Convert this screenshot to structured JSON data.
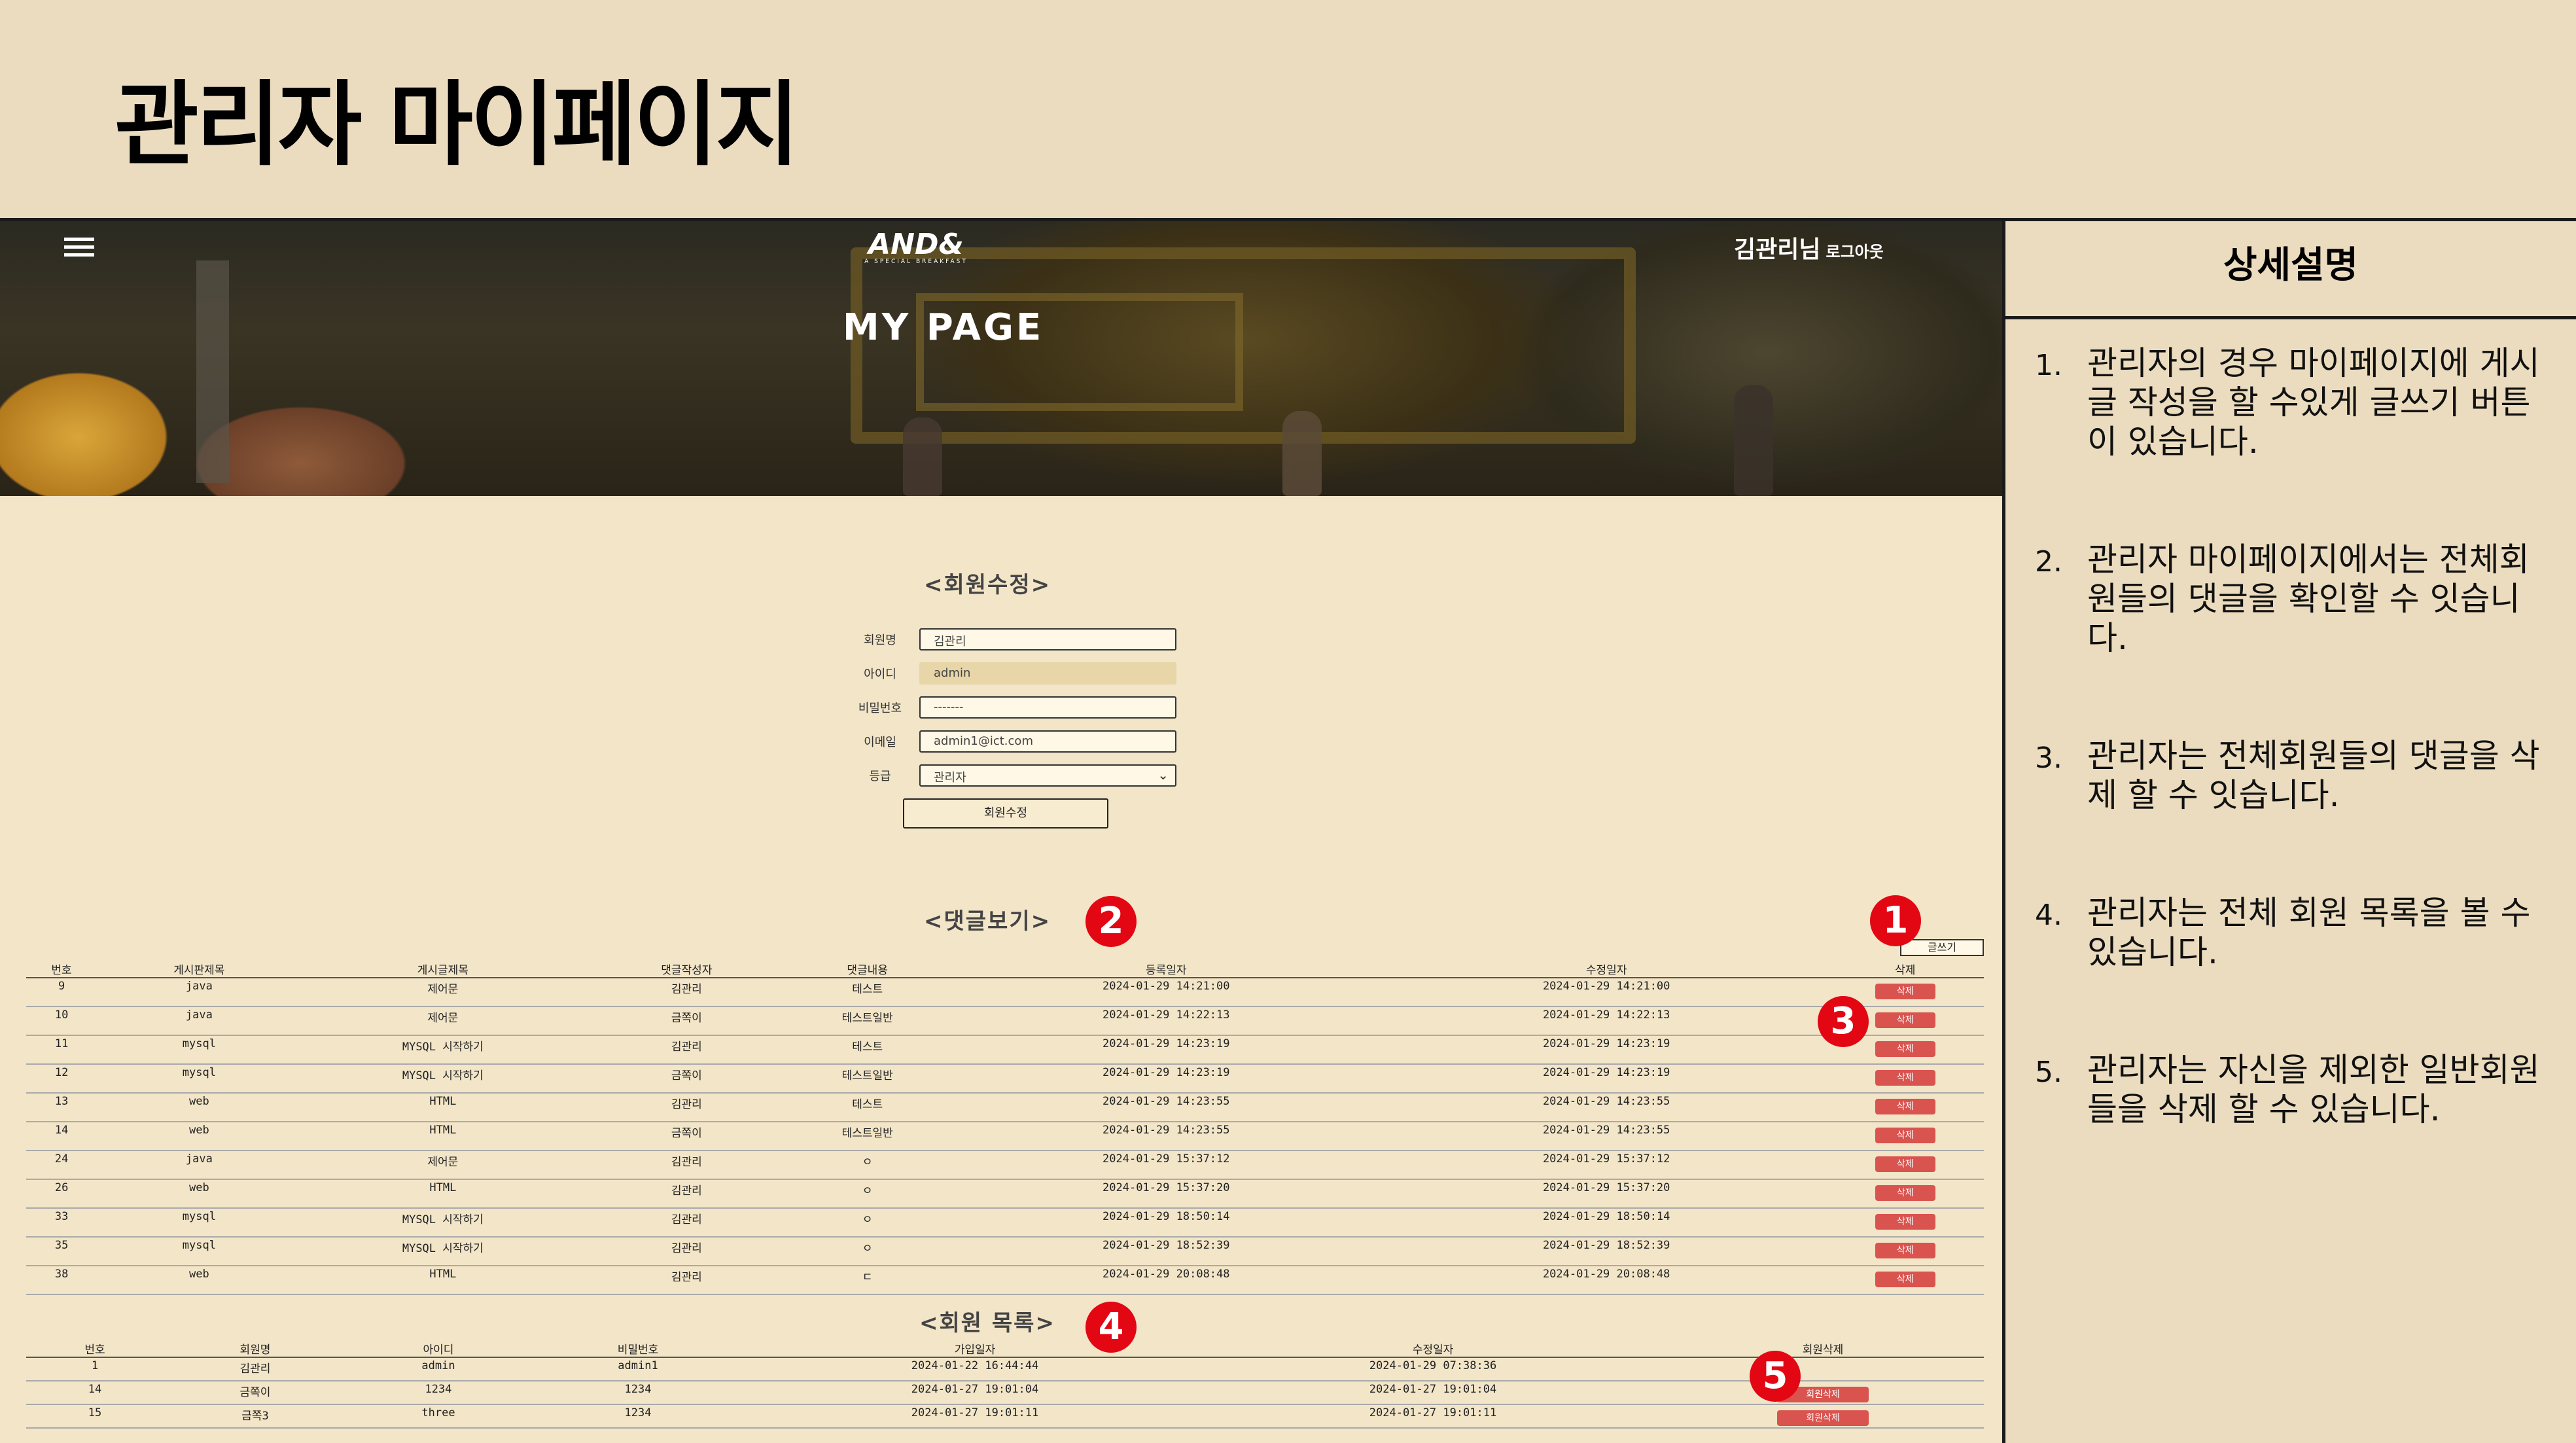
{
  "slide": {
    "title": "관리자 마이페이지"
  },
  "hero": {
    "logo": "AND&",
    "logo_sub": "A SPECIAL BREAKFAST",
    "user": "김관리님",
    "logout": "로그아웃",
    "title": "MY PAGE"
  },
  "member_edit": {
    "title": "<회원수정>",
    "name_label": "회원명",
    "name_value": "김관리",
    "id_label": "아이디",
    "id_value": "admin",
    "pw_label": "비밀번호",
    "pw_value": "-------",
    "email_label": "이메일",
    "email_value": "admin1@ict.com",
    "grade_label": "등급",
    "grade_value": "관리자",
    "submit": "회원수정"
  },
  "comments": {
    "title": "<댓글보기>",
    "write_button": "글쓰기",
    "headers": [
      "번호",
      "게시판제목",
      "게시글제목",
      "댓글작성자",
      "댓글내용",
      "등록일자",
      "수정일자",
      "삭제"
    ],
    "delete_label": "삭제",
    "rows": [
      [
        "9",
        "java",
        "제어문",
        "김관리",
        "테스트",
        "2024-01-29 14:21:00",
        "2024-01-29 14:21:00"
      ],
      [
        "10",
        "java",
        "제어문",
        "금쪽이",
        "테스트일반",
        "2024-01-29 14:22:13",
        "2024-01-29 14:22:13"
      ],
      [
        "11",
        "mysql",
        "MYSQL 시작하기",
        "김관리",
        "테스트",
        "2024-01-29 14:23:19",
        "2024-01-29 14:23:19"
      ],
      [
        "12",
        "mysql",
        "MYSQL 시작하기",
        "금쪽이",
        "테스트일반",
        "2024-01-29 14:23:19",
        "2024-01-29 14:23:19"
      ],
      [
        "13",
        "web",
        "HTML",
        "김관리",
        "테스트",
        "2024-01-29 14:23:55",
        "2024-01-29 14:23:55"
      ],
      [
        "14",
        "web",
        "HTML",
        "금쪽이",
        "테스트일반",
        "2024-01-29 14:23:55",
        "2024-01-29 14:23:55"
      ],
      [
        "24",
        "java",
        "제어문",
        "김관리",
        "ㅇ",
        "2024-01-29 15:37:12",
        "2024-01-29 15:37:12"
      ],
      [
        "26",
        "web",
        "HTML",
        "김관리",
        "ㅇ",
        "2024-01-29 15:37:20",
        "2024-01-29 15:37:20"
      ],
      [
        "33",
        "mysql",
        "MYSQL 시작하기",
        "김관리",
        "ㅇ",
        "2024-01-29 18:50:14",
        "2024-01-29 18:50:14"
      ],
      [
        "35",
        "mysql",
        "MYSQL 시작하기",
        "김관리",
        "ㅇ",
        "2024-01-29 18:52:39",
        "2024-01-29 18:52:39"
      ],
      [
        "38",
        "web",
        "HTML",
        "김관리",
        "ㄷ",
        "2024-01-29 20:08:48",
        "2024-01-29 20:08:48"
      ]
    ]
  },
  "members": {
    "title": "<회원 목록>",
    "headers": [
      "번호",
      "회원명",
      "아이디",
      "비밀번호",
      "가입일자",
      "수정일자",
      "회원삭제"
    ],
    "delete_label": "회원삭제",
    "rows": [
      [
        "1",
        "김관리",
        "admin",
        "admin1",
        "2024-01-22 16:44:44",
        "2024-01-29 07:38:36",
        false
      ],
      [
        "14",
        "금쪽이",
        "1234",
        "1234",
        "2024-01-27 19:01:04",
        "2024-01-27 19:01:04",
        true
      ],
      [
        "15",
        "금쪽3",
        "three",
        "1234",
        "2024-01-27 19:01:11",
        "2024-01-27 19:01:11",
        true
      ]
    ]
  },
  "badges": [
    "1",
    "2",
    "3",
    "4",
    "5"
  ],
  "panel": {
    "title": "상세설명",
    "notes": [
      {
        "num": "1.",
        "text": "관리자의 경우  마이페이지에 게시글 작성을 할 수있게 글쓰기 버튼이 있습니다."
      },
      {
        "num": "2.",
        "text": "관리자 마이페이지에서는 전체회원들의 댓글을 확인할 수 잇습니다."
      },
      {
        "num": "3.",
        "text": "관리자는 전체회원들의 댓글을 삭제 할 수 잇습니다."
      },
      {
        "num": "4.",
        "text": "관리자는 전체 회원 목록을 볼 수 있습니다."
      },
      {
        "num": "5.",
        "text": "관리자는 자신을 제외한 일반회원들을 삭제 할 수 있습니다."
      }
    ]
  },
  "colors": {
    "background": "#ebdcbf",
    "page": "#f2e5c8",
    "delete": "#d9534f",
    "badge": "#e30613"
  }
}
